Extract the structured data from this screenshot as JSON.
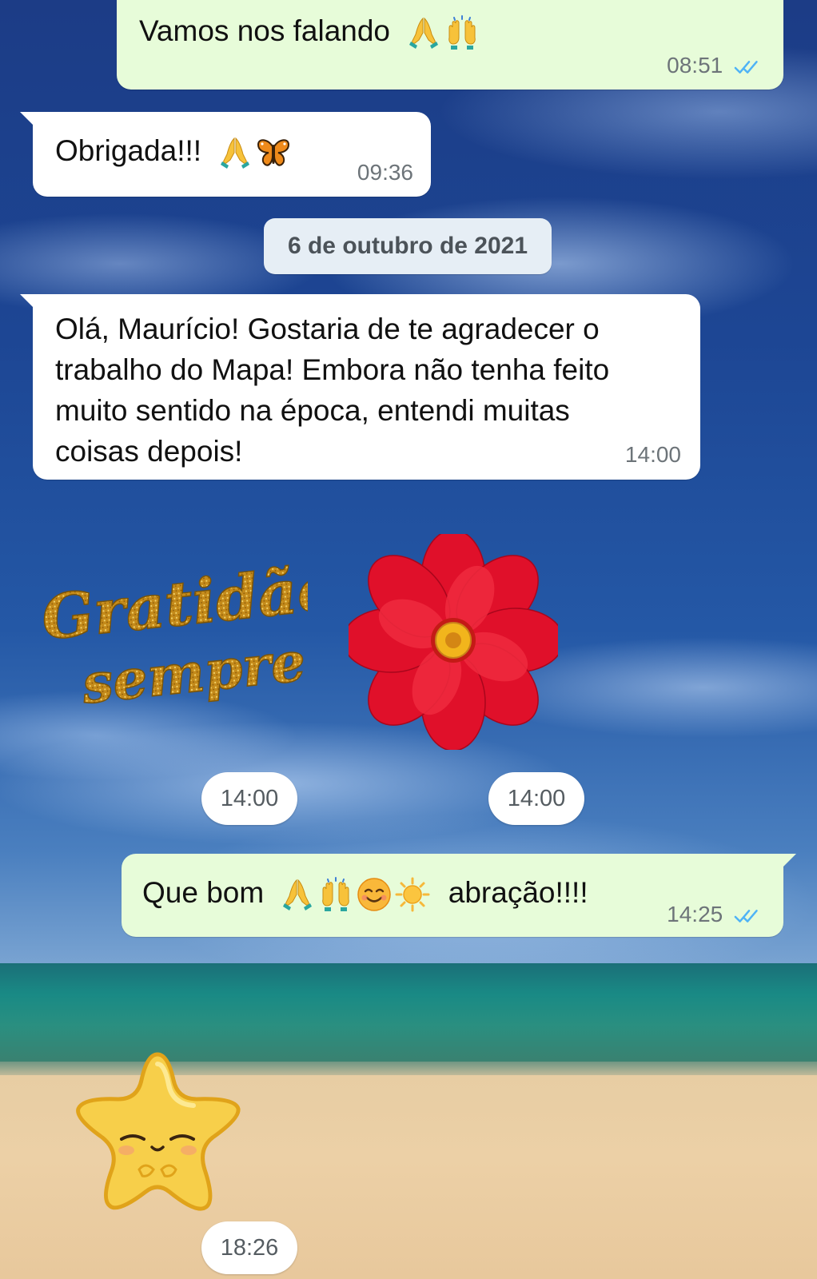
{
  "messages": [
    {
      "id": "m1",
      "direction": "outgoing",
      "text": "Vamos nos falando",
      "emojis": [
        "folded-hands-emoji",
        "raising-hands-emoji"
      ],
      "time": "08:51",
      "status": "read"
    },
    {
      "id": "m2",
      "direction": "incoming",
      "text": "Obrigada!!!",
      "emojis": [
        "folded-hands-emoji",
        "butterfly-emoji"
      ],
      "time": "09:36"
    },
    {
      "id": "m3",
      "direction": "incoming",
      "lines": [
        "Olá, Maurício! Gostaria de te agradecer o",
        "trabalho do Mapa! Embora não tenha feito",
        "muito sentido na época, entendi muitas",
        "coisas depois!"
      ],
      "time": "14:00"
    },
    {
      "id": "m6",
      "direction": "outgoing",
      "text_before": "Que bom",
      "emojis": [
        "folded-hands-emoji",
        "raising-hands-emoji",
        "smiling-face-emoji",
        "sun-emoji"
      ],
      "text_after": "abraçãо!!!!",
      "time": "14:25",
      "status": "read"
    }
  ],
  "date_separator": "6 de outubro de 2021",
  "stickers": [
    {
      "id": "gratidao",
      "lines": [
        "Gratidão",
        "sempre!"
      ],
      "time": "14:00"
    },
    {
      "id": "red-flower",
      "time": "14:00"
    },
    {
      "id": "star",
      "time": "18:26"
    }
  ],
  "colors": {
    "outgoing_bubble": "#e7fcd9",
    "incoming_bubble": "#ffffff",
    "read_ticks": "#4fb3f6",
    "timestamp": "#6d7479",
    "gold_text": "#c9921e",
    "flower_red": "#e0102a"
  }
}
